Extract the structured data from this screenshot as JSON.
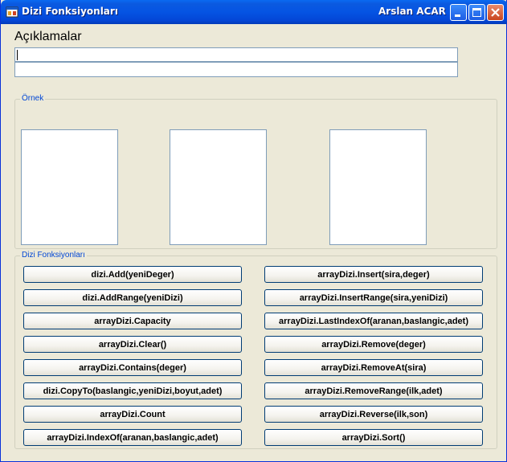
{
  "window": {
    "title": "Dizi Fonksiyonları",
    "title_right": "Arslan ACAR"
  },
  "heading": "Açıklamalar",
  "description_lines": [
    "",
    ""
  ],
  "ornek_group": {
    "label": "Örnek"
  },
  "functions_group": {
    "label": "Dizi Fonksiyonları",
    "left_buttons": [
      "dizi.Add(yeniDeger)",
      "dizi.AddRange(yeniDizi)",
      "arrayDizi.Capacity",
      "arrayDizi.Clear()",
      "arrayDizi.Contains(deger)",
      "dizi.CopyTo(baslangic,yeniDizi,boyut,adet)",
      "arrayDizi.Count",
      "arrayDizi.IndexOf(aranan,baslangic,adet)"
    ],
    "right_buttons": [
      "arrayDizi.Insert(sira,deger)",
      "arrayDizi.InsertRange(sira,yeniDizi)",
      "arrayDizi.LastIndexOf(aranan,baslangic,adet)",
      "arrayDizi.Remove(deger)",
      "arrayDizi.RemoveAt(sira)",
      "arrayDizi.RemoveRange(ilk,adet)",
      "arrayDizi.Reverse(ilk,son)",
      "arrayDizi.Sort()"
    ]
  },
  "icons": {
    "app": "window-app-icon",
    "minimize": "minimize-icon",
    "maximize": "maximize-icon",
    "close": "close-icon"
  },
  "colors": {
    "titlebar": "#0554e3",
    "window_bg": "#ece9d8",
    "group_label": "#0046d5",
    "close_button": "#c9451f"
  }
}
